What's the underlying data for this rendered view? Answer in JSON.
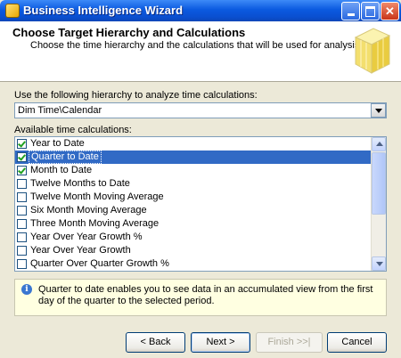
{
  "window": {
    "title": "Business Intelligence Wizard"
  },
  "header": {
    "title": "Choose Target Hierarchy and Calculations",
    "subtitle": "Choose the time hierarchy and the calculations that will be used for analysis."
  },
  "hierarchy": {
    "label": "Use the following hierarchy to analyze time calculations:",
    "selected": "Dim Time\\Calendar"
  },
  "calculations": {
    "label": "Available time calculations:",
    "items": [
      {
        "label": "Year to Date",
        "checked": true,
        "selected": false
      },
      {
        "label": "Quarter to Date",
        "checked": true,
        "selected": true
      },
      {
        "label": "Month to Date",
        "checked": true,
        "selected": false
      },
      {
        "label": "Twelve Months to Date",
        "checked": false,
        "selected": false
      },
      {
        "label": "Twelve Month Moving Average",
        "checked": false,
        "selected": false
      },
      {
        "label": "Six Month Moving Average",
        "checked": false,
        "selected": false
      },
      {
        "label": "Three Month Moving Average",
        "checked": false,
        "selected": false
      },
      {
        "label": "Year Over Year Growth %",
        "checked": false,
        "selected": false
      },
      {
        "label": "Year Over Year Growth",
        "checked": false,
        "selected": false
      },
      {
        "label": "Quarter Over Quarter Growth %",
        "checked": false,
        "selected": false
      }
    ]
  },
  "info": {
    "icon": "info-icon",
    "text": "Quarter to date enables you to see data in an accumulated view from the first day of the quarter to the selected period."
  },
  "buttons": {
    "back": "< Back",
    "next": "Next >",
    "finish": "Finish >>|",
    "cancel": "Cancel"
  }
}
